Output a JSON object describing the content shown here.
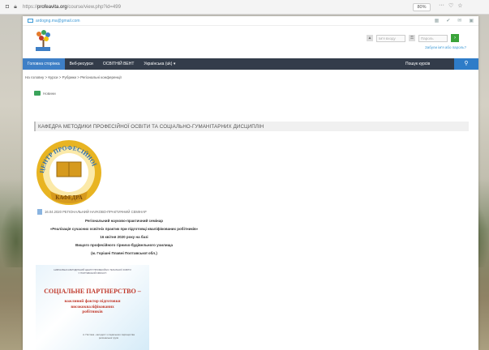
{
  "browser": {
    "url_prefix": "https://",
    "url_domain": "profeavita.org",
    "url_path": "/course/view.php?id=499",
    "zoom": "80%"
  },
  "topbar": {
    "email": "ardogng.ma@gmail.com"
  },
  "login": {
    "username_placeholder": "Ім'я входу",
    "password_placeholder": "Пароль",
    "submit": "›",
    "forgot_link": "Забули ім'я або пароль?"
  },
  "nav": {
    "items": [
      {
        "label": "Головна сторінка"
      },
      {
        "label": "Веб-ресурси"
      },
      {
        "label": "ОСВІТНІЙ ВЕНТ"
      },
      {
        "label": "Українська (uk) ▾"
      }
    ],
    "search_label": "Пошук курсів"
  },
  "breadcrumb": "На головну > Курси > Рубрики > Регіональні конференції",
  "news_label": "Новини",
  "page_title": "КАФЕДРА МЕТОДИКИ ПРОФЕСІЙНОЇ ОСВІТИ ТА СОЦІАЛЬНО-ГУМАНІТАРНИХ ДИСЦИПЛІН",
  "badge": {
    "arc_text": "ЦЕНТР ПРОФЕСІЙНОЇ",
    "bottom_text": "КАФЕДРА"
  },
  "announcement": "16.04.2020 РЕГІОНАЛЬНИЙ НАУКОВО-ПРАКТИЧНИЙ СЕМІНАР",
  "body_lines": [
    "Регіональний науково-практичний семінар",
    "«Реалізація сучасних освітніх практик при підготовці кваліфікованих робітників»",
    "16 квітня 2020 року на базі",
    "Вищого професійного гірничо-будівельного училища",
    "(м. Горішні Плавні Полтавської обл.)"
  ],
  "poster": {
    "top_lines": [
      "НАВЧАЛЬНО-МЕТОДИЧНИЙ ЦЕНТР ПРОФЕСІЙНО-ТЕХНІЧНОЇ ОСВІТИ",
      "У ПОЛТАВСЬКІЙ ОБЛАСТІ"
    ],
    "title": "СОЦІАЛЬНЕ ПАРТНЕРСТВО –",
    "subtitle_lines": [
      "важливий фактор підготовки",
      "висококваліфікованих",
      "робітників"
    ],
    "author_lines": [
      "А. Постика - методист з соціального партнерства",
      "регіональної групи"
    ]
  }
}
